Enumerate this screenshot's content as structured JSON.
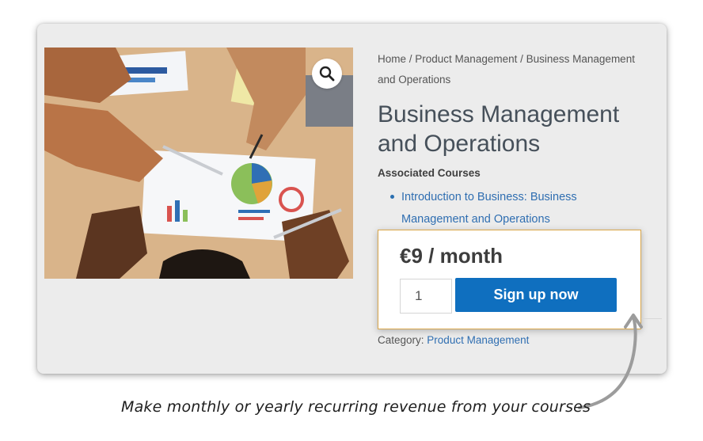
{
  "breadcrumb": {
    "home": "Home",
    "sep1": " / ",
    "category": "Product Management",
    "sep2": " / ",
    "current": "Business Management and Operations"
  },
  "product": {
    "title": "Business Management and Operations",
    "associated_label": "Associated Courses",
    "courses": [
      {
        "label": "Introduction to Business: Business Management and Operations"
      }
    ],
    "price": "€9 / month",
    "quantity": "1",
    "signup_label": "Sign up now",
    "category_label": "Category:",
    "category_value": "Product Management"
  },
  "annotation": {
    "caption": "Make monthly or yearly recurring revenue from your courses"
  },
  "icons": {
    "zoom": "magnifier-icon",
    "arrow": "curved-arrow-icon"
  },
  "colors": {
    "link": "#2f6eb1",
    "button": "#0f6fbf",
    "highlight_border": "#d9a64a",
    "card_bg": "#ececec"
  }
}
